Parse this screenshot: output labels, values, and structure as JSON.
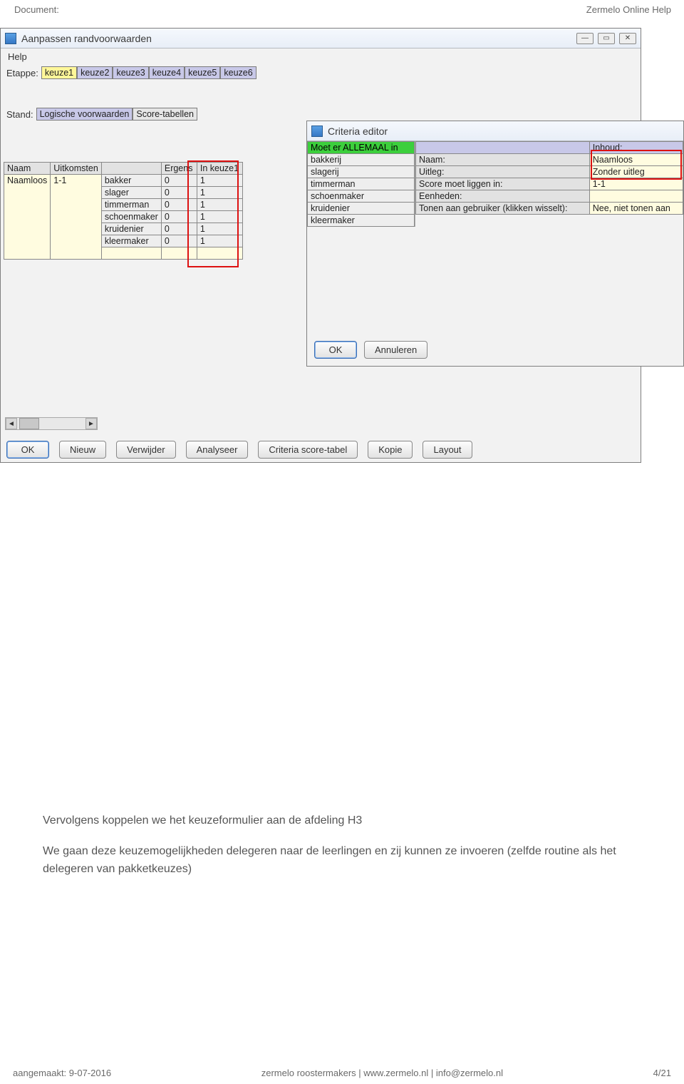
{
  "header": {
    "left": "Document:",
    "right": "Zermelo Online Help"
  },
  "mainWin": {
    "title": "Aanpassen randvoorwaarden",
    "menu": "Help",
    "etappeLabel": "Etappe:",
    "etappeTabs": [
      "keuze1",
      "keuze2",
      "keuze3",
      "keuze4",
      "keuze5",
      "keuze6"
    ],
    "standLabel": "Stand:",
    "standTabs": [
      "Logische voorwaarden",
      "Score-tabellen"
    ],
    "leftTable": {
      "headers": [
        "Naam",
        "Uitkomsten",
        "",
        "Ergens",
        "In keuze1"
      ],
      "nameCell": "Naamloos",
      "rangeCell": "1-1",
      "rows": [
        [
          "bakker",
          "0",
          "1"
        ],
        [
          "slager",
          "0",
          "1"
        ],
        [
          "timmerman",
          "0",
          "1"
        ],
        [
          "schoenmaker",
          "0",
          "1"
        ],
        [
          "kruidenier",
          "0",
          "1"
        ],
        [
          "kleermaker",
          "0",
          "1"
        ]
      ]
    },
    "buttons": [
      "OK",
      "Nieuw",
      "Verwijder",
      "Analyseer",
      "Criteria score-tabel",
      "Kopie",
      "Layout"
    ]
  },
  "criteriaEditor": {
    "title": "Criteria editor",
    "leftHeader": "Moet er ALLEMAAL in",
    "leftItems": [
      "bakkerij",
      "slagerij",
      "timmerman",
      "schoenmaker",
      "kruidenier",
      "kleermaker"
    ],
    "rightHeader": "Inhoud:",
    "rightRows": [
      {
        "label": "Naam:",
        "value": "Naamloos"
      },
      {
        "label": "Uitleg:",
        "value": "Zonder uitleg"
      },
      {
        "label": "Score moet liggen in:",
        "value": "1-1"
      },
      {
        "label": "Eenheden:",
        "value": ""
      },
      {
        "label": "Tonen aan gebruiker (klikken wisselt):",
        "value": "Nee, niet tonen aan"
      }
    ],
    "buttons": [
      "OK",
      "Annuleren"
    ]
  },
  "body": {
    "p1": "Vervolgens koppelen we het keuzeformulier aan de afdeling H3",
    "p2": "We gaan deze keuzemogelijkheden delegeren naar de leerlingen en zij kunnen ze invoeren (zelfde routine als het delegeren van pakketkeuzes)"
  },
  "footer": {
    "left": "aangemaakt: 9-07-2016",
    "center": "zermelo roostermakers | www.zermelo.nl | info@zermelo.nl",
    "right": "4/21"
  }
}
